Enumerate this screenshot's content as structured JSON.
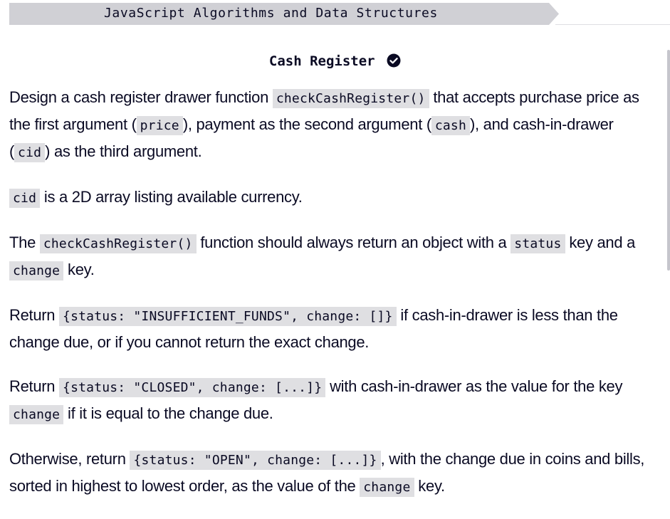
{
  "header": {
    "breadcrumb": "JavaScript Algorithms and Data Structures"
  },
  "title": "Cash Register",
  "icons": {
    "completed": "check-circle-icon"
  },
  "paragraphs": [
    {
      "t1": "Design a cash register drawer function ",
      "c1": "checkCashRegister()",
      "t2": " that accepts purchase price as the first argument (",
      "c2": "price",
      "t3": "), payment as the second argument (",
      "c3": "cash",
      "t4": "), and cash-in-drawer (",
      "c4": "cid",
      "t5": ") as the third argument."
    },
    {
      "c1": "cid",
      "t1": " is a 2D array listing available currency."
    },
    {
      "t1": "The ",
      "c1": "checkCashRegister()",
      "t2": " function should always return an object with a ",
      "c2": "status",
      "t3": " key and a ",
      "c3": "change",
      "t4": " key."
    },
    {
      "t1": "Return ",
      "c1": "{status: \"INSUFFICIENT_FUNDS\", change: []}",
      "t2": " if cash-in-drawer is less than the change due, or if you cannot return the exact change."
    },
    {
      "t1": "Return ",
      "c1": "{status: \"CLOSED\", change: [...]}",
      "t2": " with cash-in-drawer as the value for the key ",
      "c2": "change",
      "t3": " if it is equal to the change due."
    },
    {
      "t1": "Otherwise, return ",
      "c1": "{status: \"OPEN\", change: [...]}",
      "t2": ", with the change due in coins and bills, sorted in highest to lowest order, as the value of the ",
      "c2": "change",
      "t3": " key."
    }
  ]
}
